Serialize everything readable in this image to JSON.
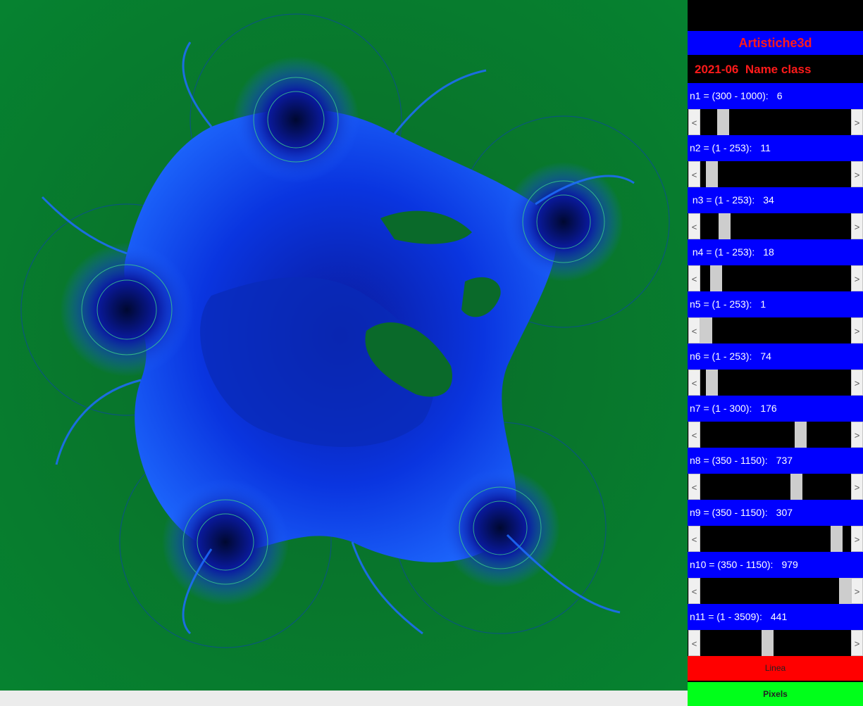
{
  "app": {
    "title": "Artistiche3d",
    "subtitle": "2021-06  Name class"
  },
  "parameters": [
    {
      "label": "n1 = (300 - 1000):",
      "value": "6",
      "min": 300,
      "max": 1000,
      "slider_fraction": 0.12
    },
    {
      "label": "n2 = (1 - 253):",
      "value": "11",
      "min": 1,
      "max": 253,
      "slider_fraction": 0.04
    },
    {
      "label": " n3 = (1 - 253):",
      "value": "34",
      "min": 1,
      "max": 253,
      "slider_fraction": 0.13
    },
    {
      "label": " n4 = (1 - 253):",
      "value": "18",
      "min": 1,
      "max": 253,
      "slider_fraction": 0.07
    },
    {
      "label": "n5 = (1 - 253):",
      "value": "1",
      "min": 1,
      "max": 253,
      "slider_fraction": 0.0
    },
    {
      "label": "n6 = (1 - 253):",
      "value": "74",
      "min": 1,
      "max": 253,
      "slider_fraction": 0.04
    },
    {
      "label": "n7 = (1 - 300):",
      "value": "176",
      "min": 1,
      "max": 300,
      "slider_fraction": 0.68
    },
    {
      "label": "n8 = (350 - 1150):",
      "value": "737",
      "min": 350,
      "max": 1150,
      "slider_fraction": 0.65
    },
    {
      "label": "n9 = (350 - 1150):",
      "value": "307",
      "min": 350,
      "max": 1150,
      "slider_fraction": 0.94
    },
    {
      "label": "n10 = (350 - 1150):",
      "value": "979",
      "min": 350,
      "max": 1150,
      "slider_fraction": 1.0
    },
    {
      "label": "n11 = (1 - 3509):",
      "value": "441",
      "min": 1,
      "max": 3509,
      "slider_fraction": 0.44
    }
  ],
  "scroll_left_glyph": "<",
  "scroll_right_glyph": ">",
  "buttons": {
    "linea": "Linea",
    "pixels": "Pixels"
  },
  "colors": {
    "background_green": "#057a2e",
    "fractal_blue": "#0a3cff",
    "panel_blue": "#0000ff",
    "title_red": "#ff1a1a",
    "linea_red": "#ff0000",
    "pixels_green": "#00ff1a"
  }
}
